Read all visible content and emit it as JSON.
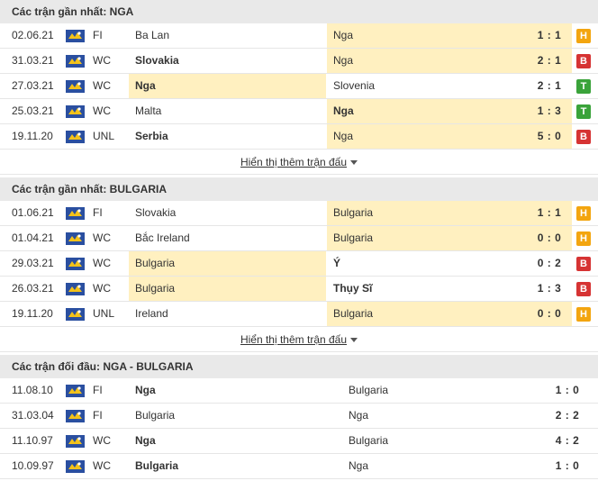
{
  "colors": {
    "win": "#3aa33a",
    "draw": "#f3a50f",
    "loss": "#d63333",
    "highlight": "#fff0c0"
  },
  "section1": {
    "title": "Các trận gần nhất: NGA",
    "more": "Hiển thị thêm trận đấu",
    "rows": [
      {
        "date": "02.06.21",
        "comp": "FI",
        "home": "Ba Lan",
        "away": "Nga",
        "score": "1 : 1",
        "result": "H"
      },
      {
        "date": "31.03.21",
        "comp": "WC",
        "home": "Slovakia",
        "away": "Nga",
        "score": "2 : 1",
        "result": "B"
      },
      {
        "date": "27.03.21",
        "comp": "WC",
        "home": "Nga",
        "away": "Slovenia",
        "score": "2 : 1",
        "result": "T"
      },
      {
        "date": "25.03.21",
        "comp": "WC",
        "home": "Malta",
        "away": "Nga",
        "score": "1 : 3",
        "result": "T"
      },
      {
        "date": "19.11.20",
        "comp": "UNL",
        "home": "Serbia",
        "away": "Nga",
        "score": "5 : 0",
        "result": "B"
      }
    ]
  },
  "section2": {
    "title": "Các trận gần nhất: BULGARIA",
    "more": "Hiển thị thêm trận đấu",
    "rows": [
      {
        "date": "01.06.21",
        "comp": "FI",
        "home": "Slovakia",
        "away": "Bulgaria",
        "score": "1 : 1",
        "result": "H"
      },
      {
        "date": "01.04.21",
        "comp": "WC",
        "home": "Bắc Ireland",
        "away": "Bulgaria",
        "score": "0 : 0",
        "result": "H"
      },
      {
        "date": "29.03.21",
        "comp": "WC",
        "home": "Bulgaria",
        "away": "Ý",
        "score": "0 : 2",
        "result": "B"
      },
      {
        "date": "26.03.21",
        "comp": "WC",
        "home": "Bulgaria",
        "away": "Thụy Sĩ",
        "score": "1 : 3",
        "result": "B"
      },
      {
        "date": "19.11.20",
        "comp": "UNL",
        "home": "Ireland",
        "away": "Bulgaria",
        "score": "0 : 0",
        "result": "H"
      }
    ]
  },
  "section3": {
    "title": "Các trận đối đầu: NGA - BULGARIA",
    "rows": [
      {
        "date": "11.08.10",
        "comp": "FI",
        "home": "Nga",
        "away": "Bulgaria",
        "score": "1 : 0"
      },
      {
        "date": "31.03.04",
        "comp": "FI",
        "home": "Bulgaria",
        "away": "Nga",
        "score": "2 : 2"
      },
      {
        "date": "11.10.97",
        "comp": "WC",
        "home": "Nga",
        "away": "Bulgaria",
        "score": "4 : 2"
      },
      {
        "date": "10.09.97",
        "comp": "WC",
        "home": "Bulgaria",
        "away": "Nga",
        "score": "1 : 0"
      }
    ]
  }
}
